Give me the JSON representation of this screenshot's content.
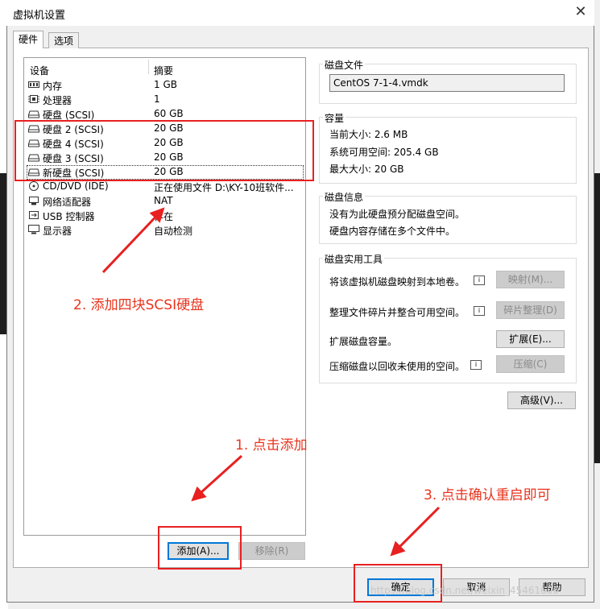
{
  "window": {
    "title": "虚拟机设置",
    "close_glyph": "✕"
  },
  "tabs": [
    {
      "label": "硬件"
    },
    {
      "label": "选项"
    }
  ],
  "device_list": {
    "headers": {
      "device": "设备",
      "summary": "摘要"
    },
    "rows": [
      {
        "name": "内存",
        "summary": "1 GB",
        "icon": "memory-icon"
      },
      {
        "name": "处理器",
        "summary": "1",
        "icon": "processor-icon"
      },
      {
        "name": "硬盘 (SCSI)",
        "summary": "60 GB",
        "icon": "hard-disk-icon"
      },
      {
        "name": "硬盘 2 (SCSI)",
        "summary": "20 GB",
        "icon": "hard-disk-icon"
      },
      {
        "name": "硬盘 4 (SCSI)",
        "summary": "20 GB",
        "icon": "hard-disk-icon"
      },
      {
        "name": "硬盘 3 (SCSI)",
        "summary": "20 GB",
        "icon": "hard-disk-icon"
      },
      {
        "name": "新硬盘 (SCSI)",
        "summary": "20 GB",
        "icon": "hard-disk-icon"
      },
      {
        "name": "CD/DVD (IDE)",
        "summary": "正在使用文件 D:\\KY-10班软件...",
        "icon": "cd-dvd-icon"
      },
      {
        "name": "网络适配器",
        "summary": "NAT",
        "icon": "network-adapter-icon"
      },
      {
        "name": "USB 控制器",
        "summary": "存在",
        "icon": "usb-icon"
      },
      {
        "name": "显示器",
        "summary": "自动检测",
        "icon": "display-icon"
      }
    ],
    "add_button": "添加(A)...",
    "remove_button": "移除(R)"
  },
  "disk_file": {
    "label": "磁盘文件",
    "value": "CentOS 7-1-4.vmdk"
  },
  "capacity": {
    "label": "容量",
    "current": "当前大小: 2.6 MB",
    "available": "系统可用空间: 205.4 GB",
    "max": "最大大小: 20 GB"
  },
  "disk_info": {
    "label": "磁盘信息",
    "line1": "没有为此硬盘预分配磁盘空间。",
    "line2": "硬盘内容存储在多个文件中。"
  },
  "disk_utilities": {
    "label": "磁盘实用工具",
    "map_text": "将该虚拟机磁盘映射到本地卷。",
    "map_button": "映射(M)...",
    "defrag_text": "整理文件碎片并整合可用空间。",
    "defrag_button": "碎片整理(D)",
    "expand_text": "扩展磁盘容量。",
    "expand_button": "扩展(E)...",
    "compact_text": "压缩磁盘以回收未使用的空间。",
    "compact_button": "压缩(C)"
  },
  "advanced_button": "高级(V)...",
  "footer": {
    "ok": "确定",
    "cancel": "取消",
    "help": "帮助"
  },
  "annotations": {
    "step1": "1. 点击添加",
    "step2": "2. 添加四块SCSI硬盘",
    "step3": "3. 点击确认重启即可"
  },
  "watermark": "https://blog.csdn.net/weixin_45461606",
  "colors": {
    "annotation_red": "#e82020",
    "focus_blue": "#0078d7"
  }
}
